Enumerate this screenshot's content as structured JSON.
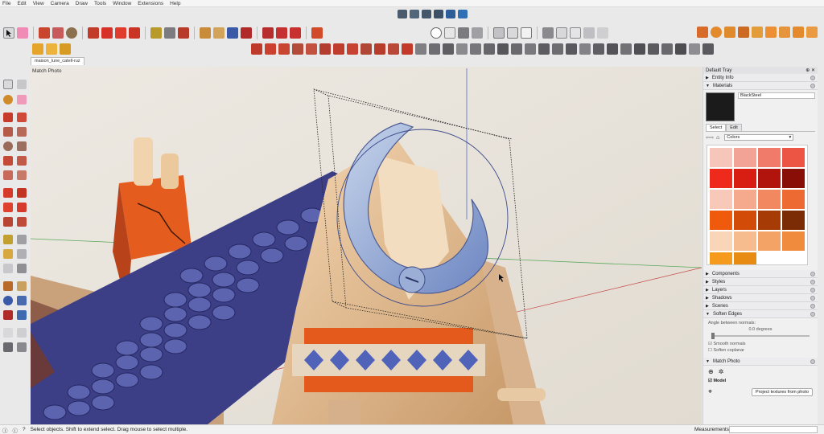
{
  "menu": [
    "File",
    "Edit",
    "View",
    "Camera",
    "Draw",
    "Tools",
    "Window",
    "Extensions",
    "Help"
  ],
  "file_tab": "maison_lune_catell-ruz",
  "scene_label": "Match Photo",
  "tray": {
    "title": "Default Tray",
    "entity_info": "Entity Info",
    "materials": "Materials",
    "material_name": "BlackSteel",
    "tab_select": "Select",
    "tab_edit": "Edit",
    "collection": "Colors",
    "swatch_colors": [
      "#f6c6bb",
      "#f3a396",
      "#f07b6b",
      "#ec5443",
      "#ee2a1c",
      "#d81d12",
      "#b0140c",
      "#8a0e08",
      "#f8c9b8",
      "#f5a98d",
      "#f2885f",
      "#ee6a33",
      "#f05a0c",
      "#d24c08",
      "#a63b06",
      "#7c2c04",
      "#f9d6b8",
      "#f7bc8e",
      "#f4a366",
      "#f08a3d",
      "#f59a1c",
      "#e88b12"
    ],
    "sections": [
      "Components",
      "Styles",
      "Layers",
      "Shadows",
      "Scenes"
    ],
    "soften_edges": "Soften Edges",
    "angle_label": "Angle between normals:",
    "angle_value": "0.0  degrees",
    "smooth_normals": "Smooth normals",
    "soften_coplanar": "Soften coplanar",
    "match_photo": "Match Photo",
    "model_label": "Model",
    "project_button": "Project textures from photo"
  },
  "status": {
    "text": "Select objects. Shift to extend select. Drag mouse to select multiple.",
    "measurements_label": "Measurements"
  }
}
